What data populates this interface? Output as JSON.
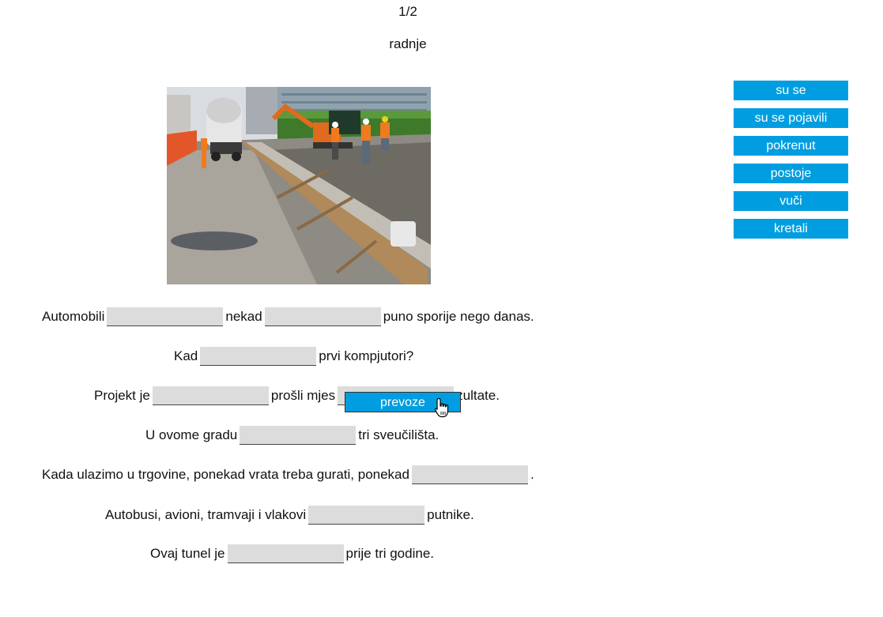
{
  "header": {
    "counter": "1/2",
    "title": "radnje"
  },
  "word_bank": [
    "su se",
    "su se pojavili",
    "pokrenut",
    "postoje",
    "vuči",
    "kretali"
  ],
  "sentences": [
    {
      "parts": [
        "Automobili",
        "nekad",
        "puno sporije nego danas."
      ]
    },
    {
      "parts": [
        "Kad",
        "prvi kompjutori?"
      ]
    },
    {
      "parts": [
        "Projekt je",
        "prošli mjes",
        "zultate."
      ]
    },
    {
      "parts": [
        "U ovome gradu",
        "tri sveučilišta."
      ]
    },
    {
      "parts": [
        "Kada ulazimo u trgovine, ponekad vrata treba gurati, ponekad",
        "."
      ]
    },
    {
      "parts": [
        "Autobusi, avioni, tramvaji i vlakovi",
        "putnike."
      ]
    },
    {
      "parts": [
        "Ovaj tunel je",
        "prije tri godine."
      ]
    }
  ],
  "dragging_chip": "prevoze",
  "colors": {
    "chip": "#009ee0",
    "blank": "#dcdcdc"
  },
  "icons": {
    "cursor": "hand-pointer-icon"
  }
}
